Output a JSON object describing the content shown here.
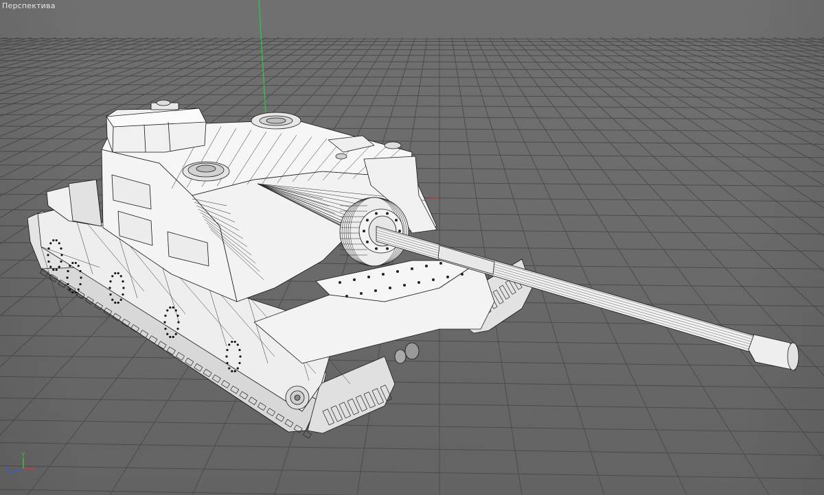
{
  "viewport": {
    "label": "Перспектива",
    "background_color": "#6c6c6c",
    "grid_color": "#4a4a4a",
    "model_color": "#ececec",
    "wire_color": "#111111"
  },
  "axes_gizmo": {
    "y_label": "Y",
    "z_label": "Z",
    "x_color": "#d23a3a",
    "y_color": "#3cc23c",
    "z_color": "#3a5ad2"
  },
  "scene": {
    "object": "tank-destroyer-wireframe",
    "world_y_axis_color": "#2ecc40"
  }
}
